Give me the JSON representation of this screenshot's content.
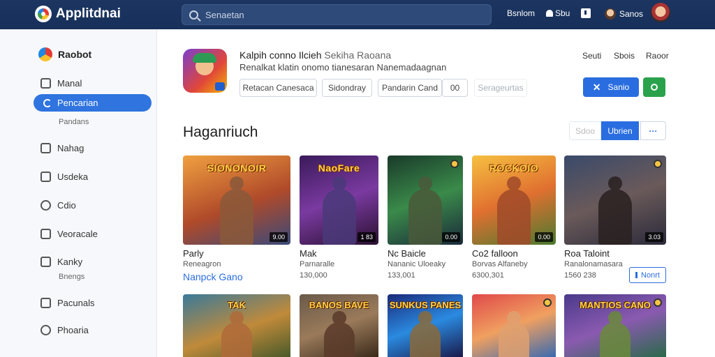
{
  "header": {
    "logo_text": "Applitdnai",
    "search_placeholder": "Senaetan",
    "links": [
      "Bsnlom",
      "Sbu",
      "Sanos"
    ]
  },
  "sidebar": {
    "heading": "Raobot",
    "items": [
      {
        "label": "Manal",
        "sub": ""
      },
      {
        "label": "Pencarian",
        "sub": "Pandans",
        "active": true
      },
      {
        "label": "Nahag",
        "sub": ""
      },
      {
        "label": "Usdeka",
        "sub": ""
      },
      {
        "label": "Cdio",
        "sub": ""
      },
      {
        "label": "Veoracale",
        "sub": ""
      },
      {
        "label": "Kanky",
        "sub": "Bnengs"
      },
      {
        "label": "Pacunals",
        "sub": ""
      },
      {
        "label": "Phoaria",
        "sub": ""
      }
    ]
  },
  "app": {
    "title": "Kalpih conno Ilcieh",
    "title_light": "Sekiha Raoana",
    "subtitle": "Renalkat klatin onomo tianesaran Nanemadaagnan",
    "meta": [
      "Seuti",
      "Sbois",
      "Raoor"
    ],
    "chips": [
      "Retacan Canesaca",
      "Sidondray",
      "Pandarin Cand",
      "00",
      "Serageurtas"
    ],
    "primary_button": "Sanio"
  },
  "section": {
    "title": "Haganriuch",
    "seg_left": "Sdoo",
    "seg_active": "Ubrien",
    "seg_more": "···"
  },
  "cards": [
    {
      "art_title": "SIONONOIR",
      "rating": "9.00",
      "name": "Parly",
      "genre": "Reneagron",
      "download": ""
    },
    {
      "art_title": "NaoFare",
      "rating": "1 83",
      "name": "Mak",
      "genre": "Parnaralle",
      "download": "130,000"
    },
    {
      "art_title": "",
      "rating": "0.00",
      "name": "Nc Baicle",
      "genre": "Nananic Uloeaky",
      "download": "133,001"
    },
    {
      "art_title": "ROCKOIO",
      "rating": "0.00",
      "name": "Co2 falloon",
      "genre": "Borvas Alfaneby",
      "download": "6300,301"
    },
    {
      "art_title": "",
      "rating": "3.03",
      "name": "Roa Taloint",
      "genre": "Ranalonamasara",
      "download": "1560 238"
    }
  ],
  "card_link": "Nanpck Gano",
  "card_button": "Nonrt",
  "row2": [
    {
      "art_title": "TAK"
    },
    {
      "art_title": "BANOS BAVE"
    },
    {
      "art_title": "SUNKUS PANES"
    },
    {
      "art_title": ""
    },
    {
      "art_title": "MANTIOS CANO"
    }
  ]
}
